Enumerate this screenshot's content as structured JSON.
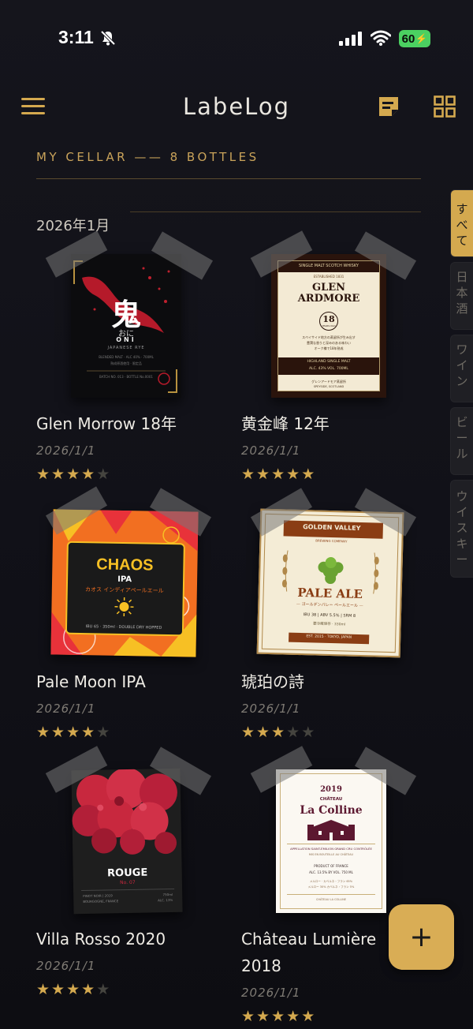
{
  "status": {
    "time": "3:11",
    "battery": "60"
  },
  "header": {
    "title": "LabeLog"
  },
  "cellar": {
    "heading": "MY CELLAR —— 8 BOTTLES",
    "month": "2026年1月"
  },
  "tabs": [
    "すべて",
    "日本酒",
    "ワイン",
    "ビール",
    "ウイスキー"
  ],
  "labels": {
    "oni": {
      "kanji": "鬼",
      "kana": "おに",
      "roman": "ONI",
      "sub": "JAPANESE RYE",
      "line1": "BLENDED MALT · ALC 40% · 700ML",
      "line2": "熟成原酒使用 · 限定品",
      "line3": "BATCH NO. 013 · BOTTLE No.0001"
    },
    "glen": {
      "top": "SINGLE MALT SCOTCH WHISKY",
      "est": "ESTABLISHED 1831",
      "name1": "GLEN",
      "name2": "ARDMORE",
      "age": "18",
      "years": "YEARS OLD",
      "jp1": "スペイサイド地方の蒸留所が生み出す",
      "jp2": "豊潤な香りと深みのある味わい",
      "jp3": "オーク樽で18年熟成",
      "band1": "HIGHLAND SINGLE MALT",
      "band2": "ALC. 43% VOL.     700ML",
      "foot1": "グレンアードモア蒸留所",
      "foot2": "SPEYSIDE, SCOTLAND"
    },
    "chaos": {
      "name": "CHAOS",
      "sub": "IPA",
      "jp": "カオス インディアペールエール",
      "foot": "IBU 65 · 350ml · DOUBLE DRY HOPPED"
    },
    "pale": {
      "brand": "GOLDEN VALLEY",
      "brand_sub": "BREWING COMPANY",
      "name": "PALE ALE",
      "jp": "— ゴールデンバレー ペールエール —",
      "stats": "IBU 38  |  ABV 5.5%  |  SRM 8",
      "vol": "要冷蔵保存 · 330ml",
      "est": "EST. 2015 · TOKYO, JAPAN"
    },
    "rouge": {
      "name": "ROUGE",
      "no": "No. 07",
      "f1": "PINOT NOIR | 2019",
      "f2": "750ml",
      "f3": "BOURGOGNE, FRANCE",
      "f4": "ALC. 13%"
    },
    "colline": {
      "year": "2019",
      "chateau": "CHÂTEAU",
      "name": "La Colline",
      "appellation": "APPELLATION SAINT-ÉMILION GRAND CRU CONTRÔLÉE",
      "mis": "MIS EN BOUTEILLE AU CHÂTEAU",
      "product": "PRODUCT OF FRANCE",
      "alc": "ALC. 13.5% BY VOL.     750 ML",
      "g1": "メルロー · カベルネ・フラン 65%",
      "g2": "メルロー 30% カベルネ・フラン 5%",
      "foot": "CHÂTEAU LA COLLINE"
    }
  },
  "bottles": [
    {
      "name": "Glen Morrow 18年",
      "date": "2026/1/1",
      "rating": 4
    },
    {
      "name": "黄金峰 12年",
      "date": "2026/1/1",
      "rating": 5
    },
    {
      "name": "Pale Moon IPA",
      "date": "2026/1/1",
      "rating": 4
    },
    {
      "name": "琥珀の詩",
      "date": "2026/1/1",
      "rating": 3
    },
    {
      "name": "Villa Rosso 2020",
      "date": "2026/1/1",
      "rating": 4
    },
    {
      "name": "Château Lumière 2018",
      "date": "2026/1/1",
      "rating": 5
    }
  ],
  "fab": {
    "label": "+"
  },
  "colors": {
    "accent": "#d4a94f",
    "background": "#121218",
    "battery": "#4bd061"
  },
  "icons": [
    "bell-slash-icon",
    "signal-icon",
    "wifi-icon",
    "menu-icon",
    "note-icon",
    "grid-icon",
    "plus-icon"
  ]
}
